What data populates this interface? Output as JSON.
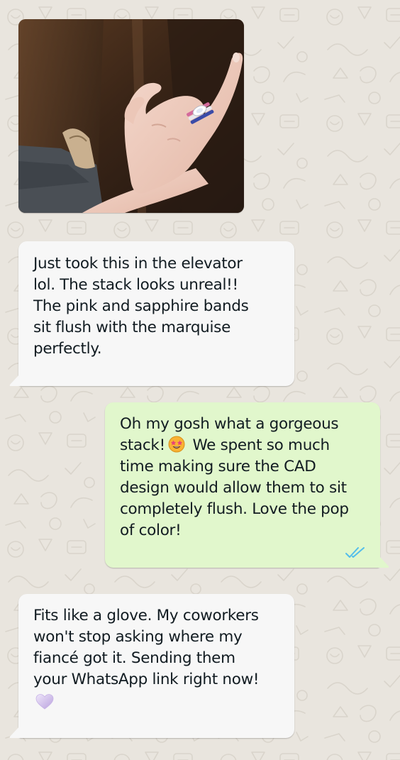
{
  "conversation": {
    "photo": {
      "subject": "photo-of-hand-with-ring-stack"
    },
    "messages": [
      {
        "direction": "incoming",
        "text": "Just took this in the elevator\nlol. The stack looks unreal!!\nThe pink and sapphire bands\nsit flush with the marquise\nperfectly."
      },
      {
        "direction": "outgoing",
        "text_before_emoji": "Oh my gosh what a gorgeous\nstack!",
        "emoji": "star-struck-emoji",
        "text_after_emoji": "We spent so much\ntime making sure the CAD\ndesign would allow them to sit\ncompletely flush. Love the pop\nof color!",
        "status": "read"
      },
      {
        "direction": "incoming",
        "text": "Fits like a glove. My coworkers\nwon't stop asking where my\nfiancé got it. Sending them\nyour WhatsApp link right now!",
        "trailing_emoji": "purple-heart-emoji"
      }
    ]
  },
  "colors": {
    "wallpaper": "#e9e5de",
    "incoming_bubble": "#f7f7f7",
    "outgoing_bubble": "#e1f7cc",
    "read_ticks": "#53bdeb",
    "text": "#111b21"
  }
}
